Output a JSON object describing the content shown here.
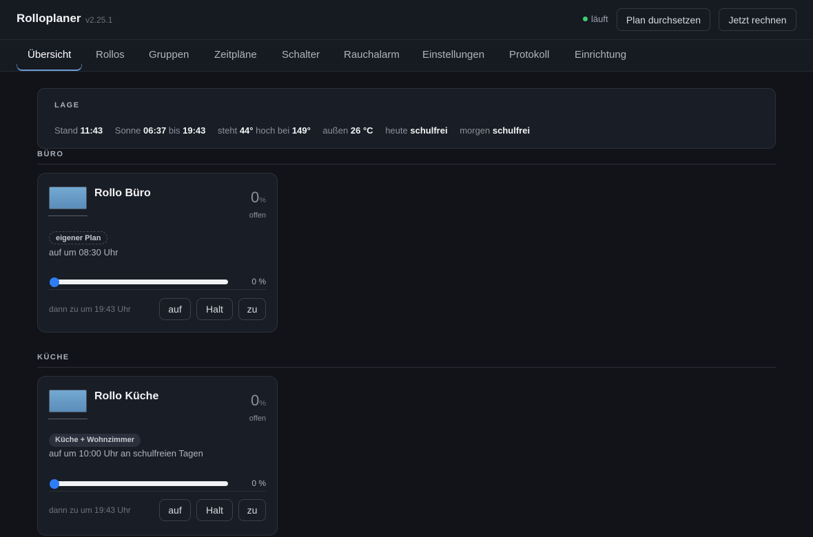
{
  "header": {
    "title": "Rolloplaner",
    "version": "v2.25.1",
    "status": "läuft",
    "status_color": "#3ecf72",
    "enforce_plan_label": "Plan durchsetzen",
    "compute_now_label": "Jetzt rechnen"
  },
  "tabs": [
    "Übersicht",
    "Rollos",
    "Gruppen",
    "Zeitpläne",
    "Schalter",
    "Rauchalarm",
    "Einstellungen",
    "Protokoll",
    "Einrichtung"
  ],
  "active_tab": "Übersicht",
  "lage": {
    "title": "LAGE",
    "stand_label": "Stand",
    "stand_value": "11:43",
    "sonne_label": "Sonne",
    "sunrise": "06:37",
    "bis_label": "bis",
    "sunset": "19:43",
    "steht_label": "steht",
    "elevation": "44°",
    "hoch_bei_label": "hoch bei",
    "azimuth": "149°",
    "aussen_label": "außen",
    "temperature": "26 °C",
    "heute_label": "heute",
    "heute_value": "schulfrei",
    "morgen_label": "morgen",
    "morgen_value": "schulfrei"
  },
  "sections": [
    {
      "label": "BÜRO",
      "card": {
        "title": "Rollo Büro",
        "percent": "0",
        "percent_unit": "%",
        "open_label": "offen",
        "badge": "eigener Plan",
        "plan_text": "auf um 08:30 Uhr",
        "slider_value": 0,
        "slider_text": "0 %",
        "next_text": "dann zu um 19:43 Uhr",
        "btn_up": "auf",
        "btn_stop": "Halt",
        "btn_down": "zu"
      }
    },
    {
      "label": "KÜCHE",
      "card": {
        "title": "Rollo Küche",
        "percent": "0",
        "percent_unit": "%",
        "open_label": "offen",
        "badge": "Küche + Wohnzimmer",
        "plan_text": "auf um 10:00 Uhr an schulfreien Tagen",
        "slider_value": 0,
        "slider_text": "0 %",
        "next_text": "dann zu um 19:43 Uhr",
        "btn_up": "auf",
        "btn_stop": "Halt",
        "btn_down": "zu"
      }
    }
  ],
  "colors": {
    "background": "#111318",
    "accent": "#2f7df6",
    "tab_indicator": "#6c9bd9"
  }
}
